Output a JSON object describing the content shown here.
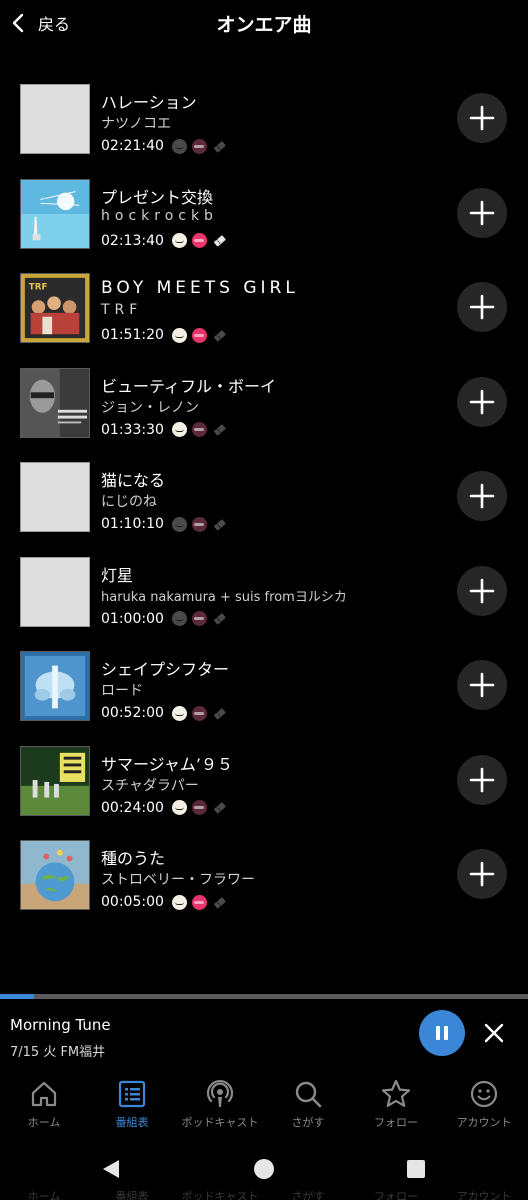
{
  "header": {
    "back_label": "戻る",
    "title": "オンエア曲"
  },
  "songs": [
    {
      "title": "ハレーション",
      "artist": "ナツノコエ",
      "time": "02:21:40",
      "services_on": [
        false,
        false,
        false
      ],
      "art": "placeholder"
    },
    {
      "title": "プレゼント交換",
      "artist": "hockrockb",
      "time": "02:13:40",
      "services_on": [
        true,
        true,
        true
      ],
      "art": "lighthouse"
    },
    {
      "title": "BOY MEETS GIRL",
      "artist": "TRF",
      "time": "01:51:20",
      "services_on": [
        true,
        true,
        false
      ],
      "art": "trf"
    },
    {
      "title": "ビューティフル・ボーイ",
      "artist": "ジョン・レノン",
      "time": "01:33:30",
      "services_on": [
        true,
        false,
        false
      ],
      "art": "lennon"
    },
    {
      "title": "猫になる",
      "artist": "にじのね",
      "time": "01:10:10",
      "services_on": [
        false,
        false,
        false
      ],
      "art": "placeholder"
    },
    {
      "title": "灯星",
      "artist": "haruka nakamura + suis fromヨルシカ",
      "time": "01:00:00",
      "services_on": [
        false,
        false,
        false
      ],
      "art": "placeholder"
    },
    {
      "title": "シェイプシフター",
      "artist": "ロード",
      "time": "00:52:00",
      "services_on": [
        true,
        false,
        false
      ],
      "art": "xray"
    },
    {
      "title": "サマージャム’９５",
      "artist": "スチャダラパー",
      "time": "00:24:00",
      "services_on": [
        true,
        false,
        false
      ],
      "art": "sdp"
    },
    {
      "title": "種のうた",
      "artist": "ストロベリー・フラワー",
      "time": "00:05:00",
      "services_on": [
        true,
        true,
        false
      ],
      "art": "globe"
    }
  ],
  "player": {
    "title": "Morning Tune",
    "subtitle": "7/15 火 FM福井",
    "progress_fraction": 0.065,
    "state": "playing"
  },
  "tabs": [
    {
      "label": "ホーム",
      "icon": "home-icon",
      "active": false
    },
    {
      "label": "番組表",
      "icon": "program-list-icon",
      "active": true
    },
    {
      "label": "ポッドキャスト",
      "icon": "podcast-icon",
      "active": false
    },
    {
      "label": "さがす",
      "icon": "search-icon",
      "active": false
    },
    {
      "label": "フォロー",
      "icon": "star-icon",
      "active": false
    },
    {
      "label": "アカウント",
      "icon": "account-icon",
      "active": false
    }
  ],
  "colors": {
    "accent": "#3b86d6",
    "service_red": "#e8356e",
    "background": "#000000"
  }
}
